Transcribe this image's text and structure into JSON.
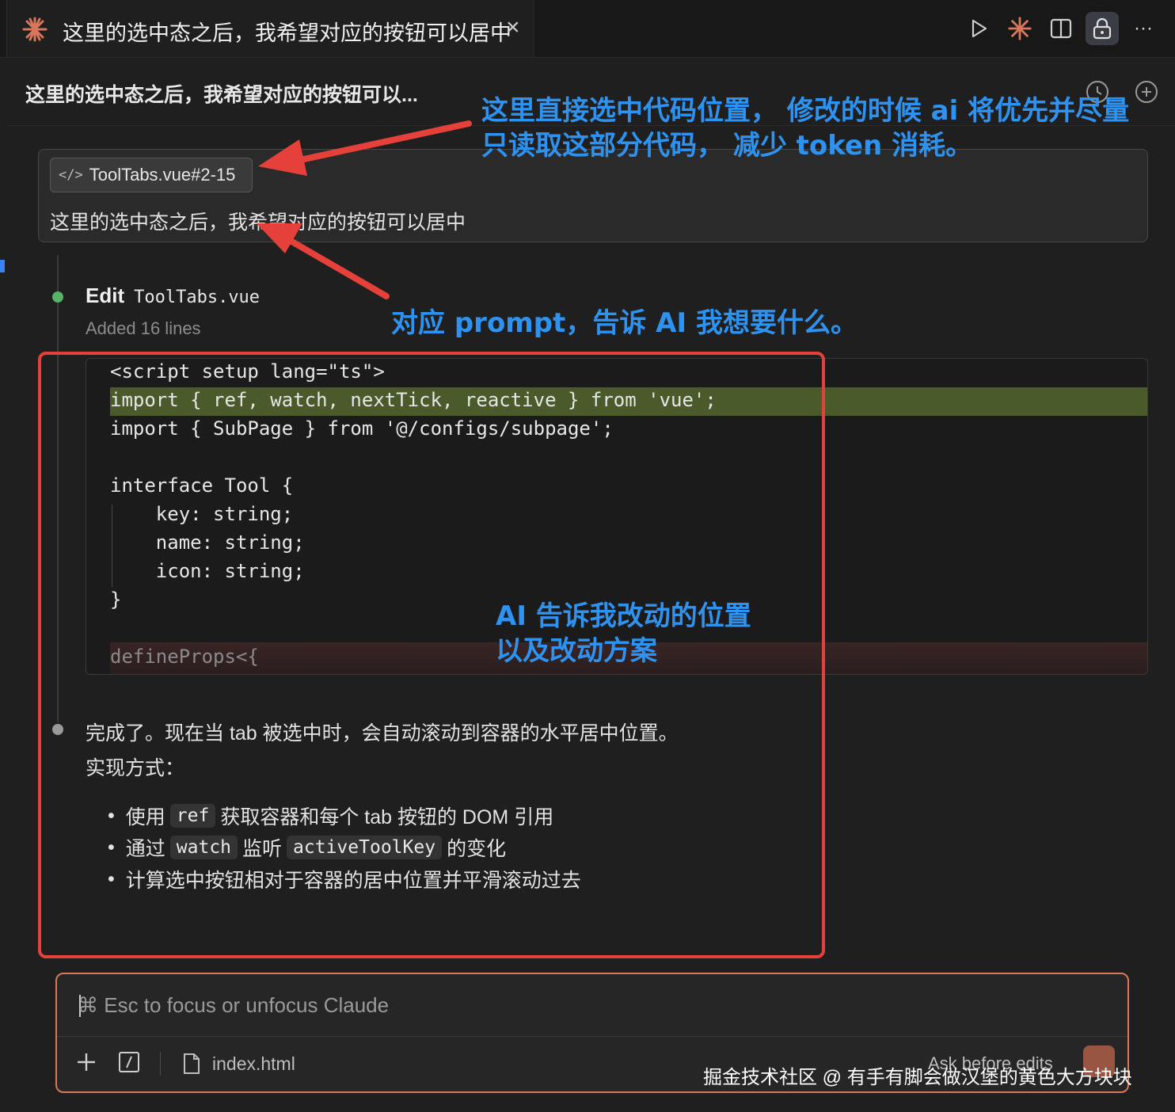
{
  "tab": {
    "title": "这里的选中态之后，我希望对应的按钮可以居中",
    "close": "×"
  },
  "toolbar": {
    "icons": [
      "play-icon",
      "claude-icon",
      "split-view-icon",
      "lock-icon",
      "more-icon"
    ]
  },
  "header": {
    "title": "这里的选中态之后，我希望对应的按钮可以..."
  },
  "message": {
    "file_chip": "ToolTabs.vue#2-15",
    "text": "这里的选中态之后，我希望对应的按钮可以居中"
  },
  "edit": {
    "verb": "Edit",
    "file": "ToolTabs.vue",
    "summary": "Added 16 lines",
    "code": [
      "<script setup lang=\"ts\">",
      "import { ref, watch, nextTick, reactive } from 'vue';",
      "import { SubPage } from '@/configs/subpage';",
      "",
      "interface Tool {",
      "    key: string;",
      "    name: string;",
      "    icon: string;",
      "}",
      "",
      "defineProps<{"
    ]
  },
  "response": {
    "line1": "完成了。现在当 tab 被选中时，会自动滚动到容器的水平居中位置。",
    "line2": "实现方式：",
    "bullets": [
      {
        "a": "使用",
        "code": "ref",
        "b": "获取容器和每个 tab 按钮的 DOM 引用"
      },
      {
        "a": "通过",
        "code": "watch",
        "b": "监听",
        "code2": "activeToolKey",
        "c": "的变化"
      },
      {
        "a": "计算选中按钮相对于容器的居中位置并平滑滚动过去"
      }
    ]
  },
  "input": {
    "placeholder": "⌘ Esc to focus or unfocus Claude",
    "file": "index.html",
    "mode": "Ask before edits"
  },
  "annotations": {
    "a1": "这里直接选中代码位置， 修改的时候 ai 将优先并尽量",
    "a1b": "只读取这部分代码， 减少 token 消耗。",
    "a2": "对应 prompt，告诉 AI 我想要什么。",
    "a3": "AI 告诉我改动的位置",
    "a3b": "以及改动方案"
  },
  "watermark": "掘金技术社区 @ 有手有脚会做汉堡的黄色大方块块",
  "colors": {
    "accent": "#d9775a",
    "annotation": "#2e93f0",
    "box": "#e5413a",
    "added": "#4a5a2b"
  }
}
